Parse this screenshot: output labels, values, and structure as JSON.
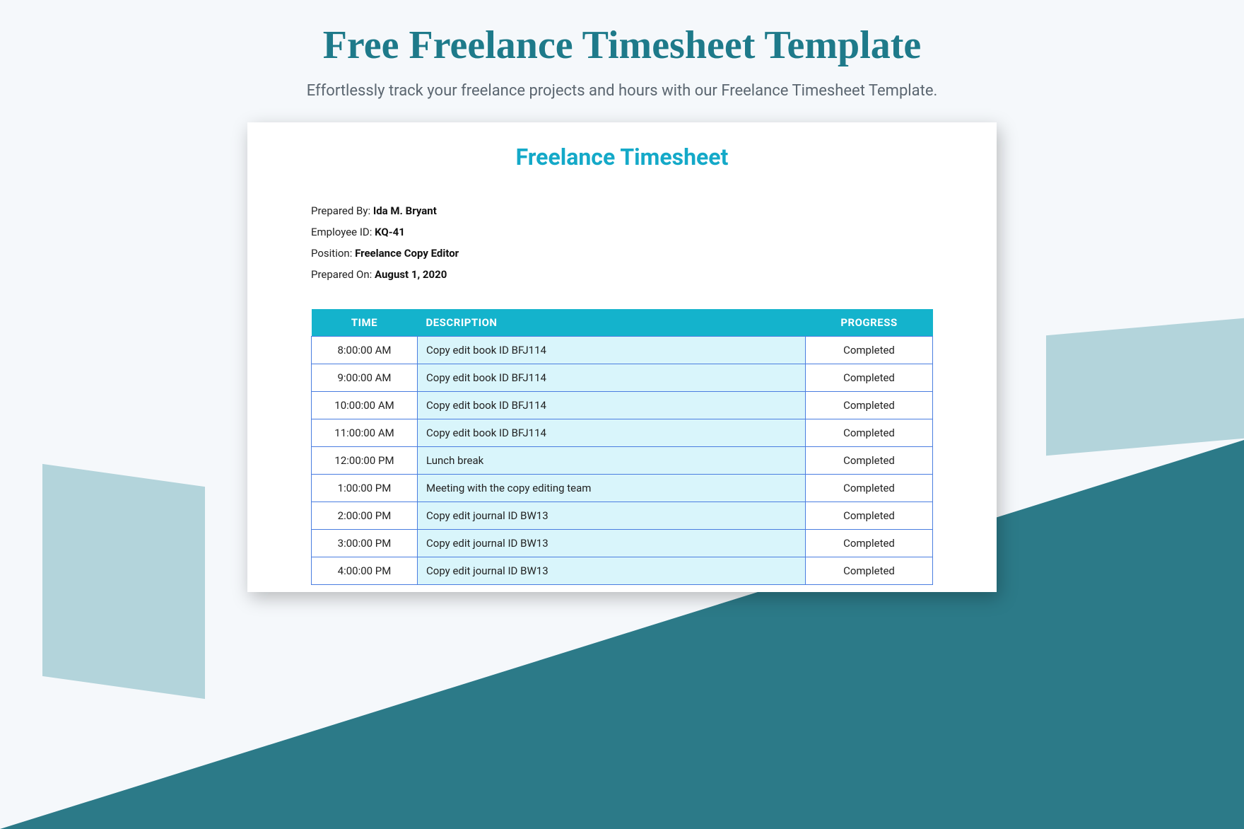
{
  "page": {
    "title": "Free Freelance Timesheet Template",
    "subtitle": "Effortlessly track your freelance projects and hours with our Freelance Timesheet Template."
  },
  "document": {
    "title": "Freelance Timesheet",
    "meta": {
      "prepared_by_label": "Prepared By: ",
      "prepared_by_value": "Ida M. Bryant",
      "employee_id_label": "Employee ID: ",
      "employee_id_value": "KQ-41",
      "position_label": "Position: ",
      "position_value": "Freelance Copy Editor",
      "prepared_on_label": "Prepared On: ",
      "prepared_on_value": "August 1, 2020"
    },
    "columns": {
      "time": "TIME",
      "description": "DESCRIPTION",
      "progress": "PROGRESS"
    },
    "rows": [
      {
        "time": "8:00:00 AM",
        "description": "Copy edit book ID BFJ114",
        "progress": "Completed"
      },
      {
        "time": "9:00:00 AM",
        "description": "Copy edit book ID BFJ114",
        "progress": "Completed"
      },
      {
        "time": "10:00:00 AM",
        "description": "Copy edit book ID BFJ114",
        "progress": "Completed"
      },
      {
        "time": "11:00:00 AM",
        "description": "Copy edit book ID BFJ114",
        "progress": "Completed"
      },
      {
        "time": "12:00:00 PM",
        "description": "Lunch break",
        "progress": "Completed"
      },
      {
        "time": "1:00:00 PM",
        "description": "Meeting with the copy editing team",
        "progress": "Completed"
      },
      {
        "time": "2:00:00 PM",
        "description": "Copy edit journal ID BW13",
        "progress": "Completed"
      },
      {
        "time": "3:00:00 PM",
        "description": "Copy edit journal ID BW13",
        "progress": "Completed"
      },
      {
        "time": "4:00:00 PM",
        "description": "Copy edit journal ID BW13",
        "progress": "Completed"
      }
    ]
  }
}
